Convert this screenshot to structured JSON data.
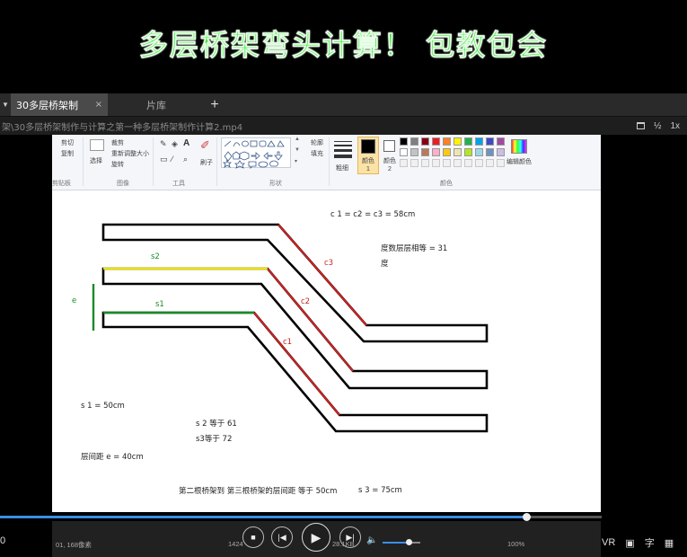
{
  "banner": {
    "title": "多层桥架弯头计算！ 包教包会"
  },
  "player": {
    "tabs": [
      {
        "label": "30多层桥架制",
        "close": "×",
        "active": true
      },
      {
        "label": "片库",
        "active": false
      }
    ],
    "add_tab": "+",
    "path": "架\\30多层桥架制作与计算之第一种多层桥架制作计算2.mp4",
    "path_tools": {
      "half": "½",
      "speed": "1x"
    },
    "progress": 0.875,
    "volume": 0.7,
    "right_tools": {
      "vr": "VR",
      "subtitle": "字"
    }
  },
  "paint": {
    "groups": [
      "剪贴板",
      "图像",
      "工具",
      "形状",
      "颜色"
    ],
    "clipboard": {
      "cut": "剪切",
      "copy": "复制"
    },
    "image": {
      "select": "选择",
      "crop": "裁剪",
      "resize": "重新调整大小",
      "rotate": "旋转"
    },
    "tools": {
      "brush": "刷子"
    },
    "shapes": {
      "outline": "轮廓",
      "fill": "填充"
    },
    "size": "粗细",
    "color1": "颜色 1",
    "color2": "颜色 2",
    "edit_colors": "编辑颜色",
    "palette_row1": [
      "#000000",
      "#7f7f7f",
      "#880015",
      "#ed1c24",
      "#ff7f27",
      "#fff200",
      "#22b14c",
      "#00a2e8",
      "#3f48cc",
      "#a349a4"
    ],
    "palette_row2": [
      "#ffffff",
      "#c3c3c3",
      "#b97a57",
      "#ffaec9",
      "#ffc90e",
      "#efe4b0",
      "#b5e61d",
      "#99d9ea",
      "#7092be",
      "#c8bfe7"
    ],
    "status": {
      "position": "01, 168像素",
      "size": "1424",
      "filesize": "28.1KB",
      "zoom": "100%"
    }
  },
  "drawing": {
    "formula_c": "c 1 = c2 = c3 = 58cm",
    "angle_line1": "度数层层相等 = 31",
    "angle_line2": "度",
    "label_s2": "s2",
    "label_s1": "s1",
    "label_e": "e",
    "label_c3": "c3",
    "label_c2": "c2",
    "label_c1": "c1",
    "s1_value": "s 1 = 50cm",
    "s2_value": "s 2 等于 61",
    "s3_value_a": "s3等于 72",
    "spacing": "层间距 e = 40cm",
    "second_third": "第二根桥架到 第三根桥架的层间距 等于 50cm",
    "s3_value_b": "s 3 = 75cm",
    "colors": {
      "green": "#1a8a2a",
      "yellow": "#e8e000",
      "red": "#e02020",
      "black": "#000000"
    }
  }
}
